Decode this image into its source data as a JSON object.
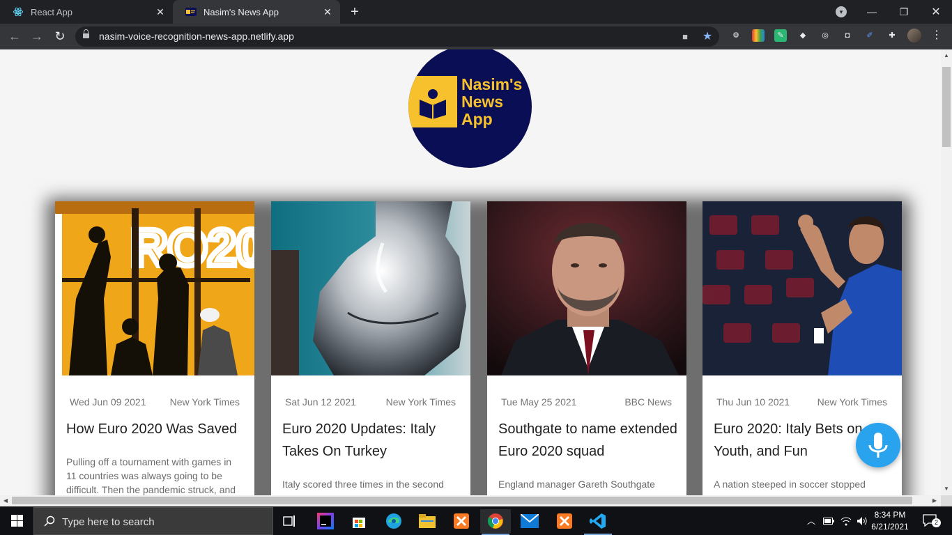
{
  "browser": {
    "tabs": [
      {
        "label": "React App",
        "favicon": "react-icon",
        "active": false
      },
      {
        "label": "Nasim's News App",
        "favicon": "news-app-icon",
        "active": true
      }
    ],
    "url": "nasim-voice-recognition-news-app.netlify.app",
    "new_tab_label": "+",
    "back_icon": "←",
    "forward_icon": "→",
    "reload_icon": "↻"
  },
  "logo": {
    "lines": [
      "Nasim's",
      "News",
      "App"
    ],
    "colors": {
      "circle": "#0a0f55",
      "accent": "#f7c12e"
    }
  },
  "articles": [
    {
      "date": "Wed Jun 09 2021",
      "source": "New York Times",
      "title": "How Euro 2020 Was Saved",
      "description": "Pulling off a tournament with games in 11 countries was always going to be difficult. Then the pandemic struck, and",
      "image_text": "RO20"
    },
    {
      "date": "Sat Jun 12 2021",
      "source": "New York Times",
      "title": "Euro 2020 Updates: Italy Takes On Turkey",
      "description": "Italy scored three times in the second"
    },
    {
      "date": "Tue May 25 2021",
      "source": "BBC News",
      "title": "Southgate to name extended Euro 2020 squad",
      "description": "England manager Gareth Southgate"
    },
    {
      "date": "Thu Jun 10 2021",
      "source": "New York Times",
      "title": "Euro 2020: Italy Bets on Youth, and Fun",
      "description": "A nation steeped in soccer stopped"
    }
  ],
  "mic_button": {
    "icon": "microphone-icon",
    "color": "#2aa3ee"
  },
  "taskbar": {
    "search_placeholder": "Type here to search",
    "time": "8:34 PM",
    "date": "6/21/2021",
    "notification_count": "2"
  }
}
